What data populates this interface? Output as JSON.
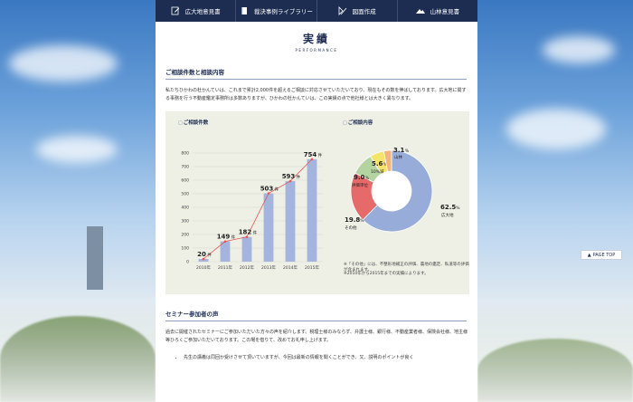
{
  "nav": {
    "items": [
      {
        "label": "広大地意見書",
        "icon": "edit-icon"
      },
      {
        "label": "裁決事例ライブラリー",
        "icon": "book-icon"
      },
      {
        "label": "図面作成",
        "icon": "drafting-icon"
      },
      {
        "label": "山林意見書",
        "icon": "mountain-icon"
      }
    ]
  },
  "page_top": "PAGE TOP",
  "heading": {
    "jp": "実績",
    "en": "PERFORMANCE"
  },
  "section1": {
    "title": "ご相談件数と相談内容",
    "text": "私たちひかわの杜かんていは、これまで累計2,000件を超えるご相談に対応させていただいており、現在もその数を伸ばしております。広大地に関する事務を行う不動産鑑定事務所は多数ありますが、ひかわの杜かんていは、この実績の点で他社様とは大きく異なります。"
  },
  "section2": {
    "title": "セミナー参加者の声",
    "text": "過去に開催されたセミナーにご参加いただいた方々の声を紹介します。税理士様のみならず、弁護士様、銀行様、不動産業者様、保険会社様、地主様等ひろくご参加いただいております。この場を借りて、改めてお礼申し上げます。",
    "bullet": "先生の講義は同回か受けさせて頂いていますが、今回は最新の情報を聞くことができ、又、説明のポイントが良く"
  },
  "chart_data": [
    {
      "type": "line",
      "title": "ご相談件数",
      "categories": [
        "2010年",
        "2011年",
        "2012年",
        "2013年",
        "2014年",
        "2015年"
      ],
      "values": [
        20,
        149,
        182,
        503,
        593,
        754
      ],
      "value_labels": [
        "20",
        "149",
        "182",
        "503",
        "593",
        "754"
      ],
      "value_suffix": "件",
      "ylim": [
        0,
        800
      ],
      "yticks": [
        0,
        100,
        200,
        300,
        400,
        500,
        600,
        700,
        800
      ],
      "grid": true,
      "bar_color": "#a5b4dc",
      "line_color": "#e15757"
    },
    {
      "type": "pie",
      "title": "ご相談内容",
      "slices": [
        {
          "label": "広大地",
          "value": 62.5,
          "color": "#98acd9",
          "display": "62.5"
        },
        {
          "label": "その他",
          "value": 19.8,
          "color": "#e66a6a",
          "display": "19.8"
        },
        {
          "label": "評価単位",
          "value": 9.0,
          "color": "#b3d3a1",
          "display": "9.0"
        },
        {
          "label": "10%減",
          "value": 5.6,
          "color": "#f5e36c",
          "display": "5.6"
        },
        {
          "label": "山林",
          "value": 3.1,
          "color": "#f3b57b",
          "display": "3.1"
        }
      ],
      "unit": "%",
      "notes": [
        "※「その他」には、不整形地補正の評価、農地の鑑定、私道等の評価が含まれます。",
        "※2010年から2015年までの実績によります。"
      ]
    }
  ]
}
